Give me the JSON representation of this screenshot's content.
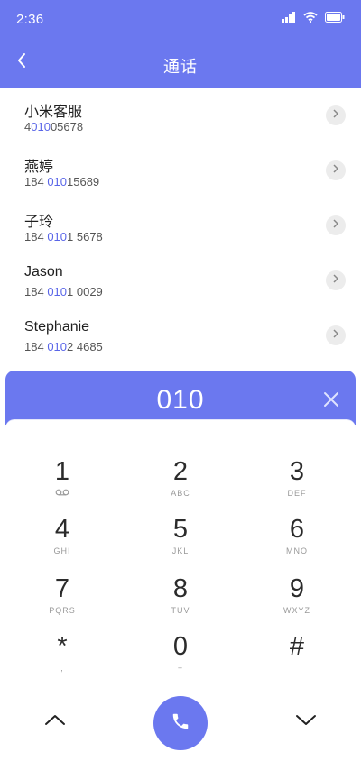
{
  "status": {
    "time": "2:36"
  },
  "nav": {
    "title": "通话"
  },
  "contacts": [
    {
      "name": "小米客服",
      "num_pre": "4",
      "num_hl": "010",
      "num_post": "05678"
    },
    {
      "name": "燕婷",
      "num_pre": "184 ",
      "num_hl": "010",
      "num_post": "15689"
    },
    {
      "name": "子玲",
      "num_pre": "184 ",
      "num_hl": "010",
      "num_post": "1 5678"
    },
    {
      "name": "Jason",
      "num_pre": "184 ",
      "num_hl": "010",
      "num_post": "1 0029"
    },
    {
      "name": "Stephanie",
      "num_pre": "184 ",
      "num_hl": "010",
      "num_post": "2 4685"
    }
  ],
  "dialer": {
    "input_value": "010",
    "keys": [
      {
        "digit": "1",
        "sub": ""
      },
      {
        "digit": "2",
        "sub": "ABC"
      },
      {
        "digit": "3",
        "sub": "DEF"
      },
      {
        "digit": "4",
        "sub": "GHI"
      },
      {
        "digit": "5",
        "sub": "JKL"
      },
      {
        "digit": "6",
        "sub": "MNO"
      },
      {
        "digit": "7",
        "sub": "PQRS"
      },
      {
        "digit": "8",
        "sub": "TUV"
      },
      {
        "digit": "9",
        "sub": "WXYZ"
      },
      {
        "digit": "*",
        "sub": ","
      },
      {
        "digit": "0",
        "sub": "+"
      },
      {
        "digit": "#",
        "sub": ""
      }
    ]
  },
  "colors": {
    "accent": "#6b78ef",
    "highlight": "#5a66e8"
  },
  "icons": {
    "back": "chevron-left-icon",
    "clear": "close-icon",
    "voicemail": "voicemail-icon",
    "call": "phone-icon",
    "up": "chevron-up-icon",
    "down": "chevron-down-icon"
  }
}
